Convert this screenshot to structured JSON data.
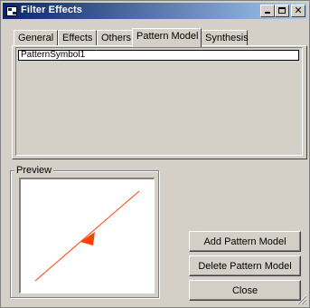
{
  "window": {
    "title": "Filter Effects",
    "icon": "filter-app-icon",
    "controls": {
      "minimize": "minimize-icon",
      "maximize": "maximize-icon",
      "close": "close-icon"
    }
  },
  "tabs": [
    {
      "label": "General"
    },
    {
      "label": "Effects"
    },
    {
      "label": "Others"
    },
    {
      "label": "Pattern Model",
      "active": true
    },
    {
      "label": "Synthesis"
    }
  ],
  "pattern_list": {
    "items": [
      "PatternSymbol1"
    ],
    "selected_index": 0
  },
  "preview": {
    "legend": "Preview",
    "line_color": "#ff4000",
    "arrow_direction": "down-left"
  },
  "buttons": {
    "add": "Add Pattern Model",
    "delete": "Delete Pattern Model",
    "close": "Close"
  }
}
